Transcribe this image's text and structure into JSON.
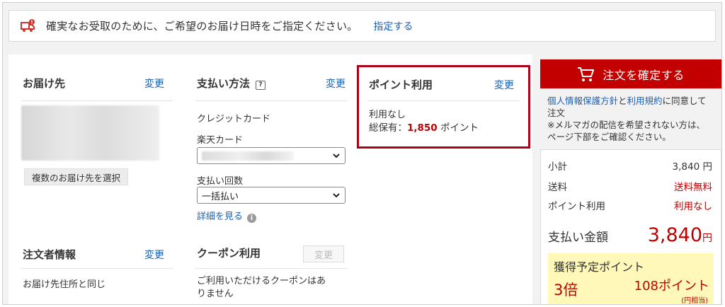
{
  "notice": {
    "text": "確実なお受取のために、ご希望のお届け日時をご指定ください。",
    "link": "指定する"
  },
  "delivery": {
    "title": "お届け先",
    "change": "変更",
    "multi_button": "複数のお届け先を選択"
  },
  "payment": {
    "title": "支払い方法",
    "change": "変更",
    "method": "クレジットカード",
    "card_label": "楽天カード",
    "installment_label": "支払い回数",
    "installment_value": "一括払い",
    "details_link": "詳細を見る"
  },
  "points": {
    "title": "ポイント利用",
    "change": "変更",
    "usage": "利用なし",
    "total_label": "総保有：",
    "total_value": "1,850",
    "total_unit": "ポイント"
  },
  "orderer": {
    "title": "注文者情報",
    "change": "変更",
    "text": "お届け先住所と同じ"
  },
  "coupon": {
    "title": "クーポン利用",
    "change": "変更",
    "text_line1": "ご利用いただけるクーポンはあ",
    "text_line2": "りません"
  },
  "sidebar": {
    "confirm_button": "注文を確定する",
    "agree_link1": "個人情報保護方針",
    "agree_and": "と",
    "agree_link2": "利用規約",
    "agree_rest1": "に同意して",
    "agree_rest2": "注文",
    "mail_note_line1": "※メルマガの配信を希望されない方は、",
    "mail_note_line2": "ページ下部をご確認ください。"
  },
  "summary": {
    "subtotal_label": "小計",
    "subtotal_value": "3,840 円",
    "shipping_label": "送料",
    "shipping_value": "送料無料",
    "point_label": "ポイント利用",
    "point_value": "利用なし",
    "pay_label": "支払い金額",
    "pay_amount": "3,840",
    "pay_unit": "円",
    "earn_title": "獲得予定ポイント",
    "earn_multiplier": "3倍",
    "earn_points": "108ポイント",
    "earn_note": "(円相当)"
  },
  "colors": {
    "accent_red": "#bf0000",
    "button_red": "#c20000",
    "link_blue": "#1b5fb4",
    "earn_bg": "#fff8b8"
  }
}
